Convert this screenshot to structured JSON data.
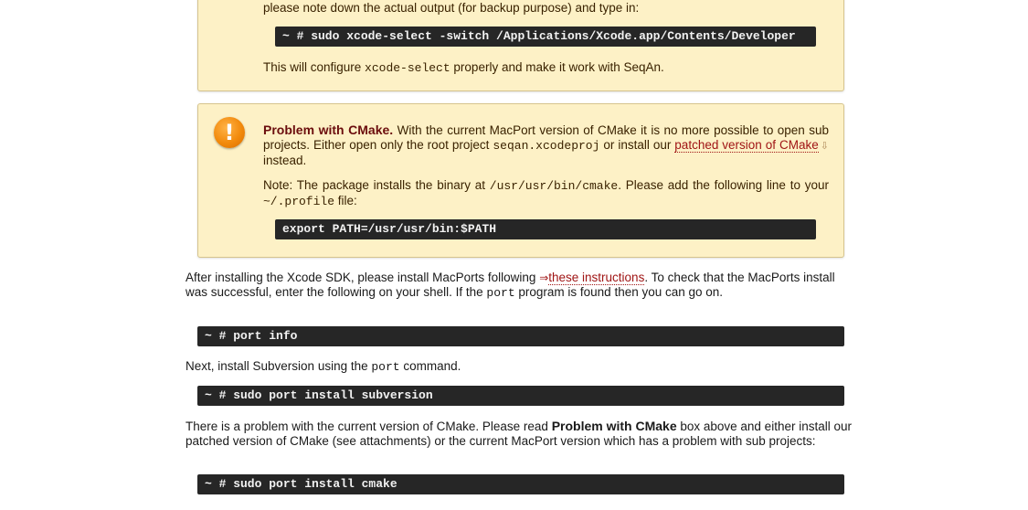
{
  "box1": {
    "line1": "please note down the actual output (for backup purpose) and type in:",
    "code": "~ # sudo xcode-select -switch /Applications/Xcode.app/Contents/Developer",
    "line2_before": "This will configure ",
    "line2_code": "xcode-select",
    "line2_after": " properly and make it work with SeqAn."
  },
  "box2": {
    "title": "Problem with CMake.",
    "p1_a": " With the current MacPort version of CMake it is no more possible to open sub projects. Either open only the root project ",
    "p1_code": "seqan.xcodeproj",
    "p1_b": " or install our ",
    "p1_link": "patched version of CMake",
    "p1_c": " instead.",
    "p2_a": "Note: The package installs the binary at ",
    "p2_code1": "/usr/usr/bin/cmake",
    "p2_b": ". Please add the following line to your ",
    "p2_code2": "~/.profile",
    "p2_c": " file:",
    "code": "export PATH=/usr/usr/bin:$PATH",
    "icon": "warning-icon"
  },
  "para1": {
    "a": "After installing the Xcode SDK, please install MacPorts following ",
    "link": "these instructions",
    "b": ". To check that the MacPorts install was successful, enter the following on your shell. If the ",
    "code": "port",
    "c": " program is found then you can go on."
  },
  "code1": "~ # port info",
  "para2": {
    "a": "Next, install Subversion using the ",
    "code": "port",
    "b": " command."
  },
  "code2": "~ # sudo port install subversion",
  "para3": {
    "a": "There is a problem with the current version of CMake. Please read ",
    "bold": "Problem with CMake",
    "b": " box above and either install our patched version of CMake (see attachments) or the current MacPort version which has a problem with sub projects:"
  },
  "code3": "~ # sudo port install cmake",
  "colors": {
    "note_bg": "#fdf1c6",
    "note_border": "#d6c48e",
    "code_bg": "#262626",
    "link": "#a01515",
    "warning": "#f28a0c"
  }
}
